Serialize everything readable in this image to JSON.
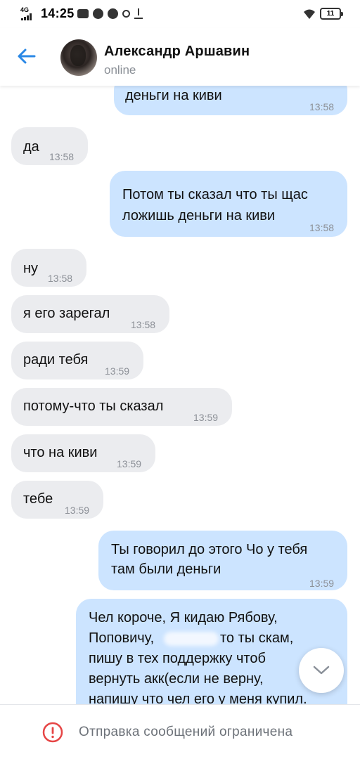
{
  "statusbar": {
    "network": "4G",
    "time": "14:25",
    "battery": "11",
    "icons": [
      "chat-app-icon",
      "vk-icon",
      "telegram-icon",
      "signal-icon",
      "download-icon"
    ]
  },
  "header": {
    "back_icon": "arrow-left-icon",
    "contact_name": "Александр Аршавин",
    "contact_status": "online"
  },
  "messages": [
    {
      "direction": "out",
      "text": "деньги на киви",
      "time": "13:58"
    },
    {
      "direction": "in",
      "text": "да",
      "time": "13:58"
    },
    {
      "direction": "out",
      "lines": [
        "Потом ты сказал что ты щас",
        "ложишь деньги на киви"
      ],
      "time": "13:58"
    },
    {
      "direction": "in",
      "text": "ну",
      "time": "13:58"
    },
    {
      "direction": "in",
      "text": "я его зарегал",
      "time": "13:58"
    },
    {
      "direction": "in",
      "text": "ради тебя",
      "time": "13:59"
    },
    {
      "direction": "in",
      "text": "потому-что ты сказал",
      "time": "13:59"
    },
    {
      "direction": "in",
      "text": "что на киви",
      "time": "13:59"
    },
    {
      "direction": "in",
      "text": "тебе",
      "time": "13:59"
    },
    {
      "direction": "out",
      "lines": [
        "Ты говорил до этого Чо у тебя",
        "там были деньги"
      ],
      "time": "13:59"
    },
    {
      "direction": "out",
      "lines": [
        "Чел короче, Я кидаю Рябову,",
        "Поповичу,",
        "то ты скам,",
        "пишу в тех поддержку чтоб",
        "вернуть акк(если не верну,",
        "напишу что чел его у меня купил."
      ]
    }
  ],
  "scroll_down_icon": "chevron-down-icon",
  "footer": {
    "warning_icon": "exclamation-circle-icon",
    "restricted_text": "Отправка сообщений ограничена",
    "accent_red": "#e64646"
  },
  "colors": {
    "accent": "#2a88e6",
    "incoming_bubble": "#ebecef",
    "outgoing_bubble": "#cce4ff"
  }
}
